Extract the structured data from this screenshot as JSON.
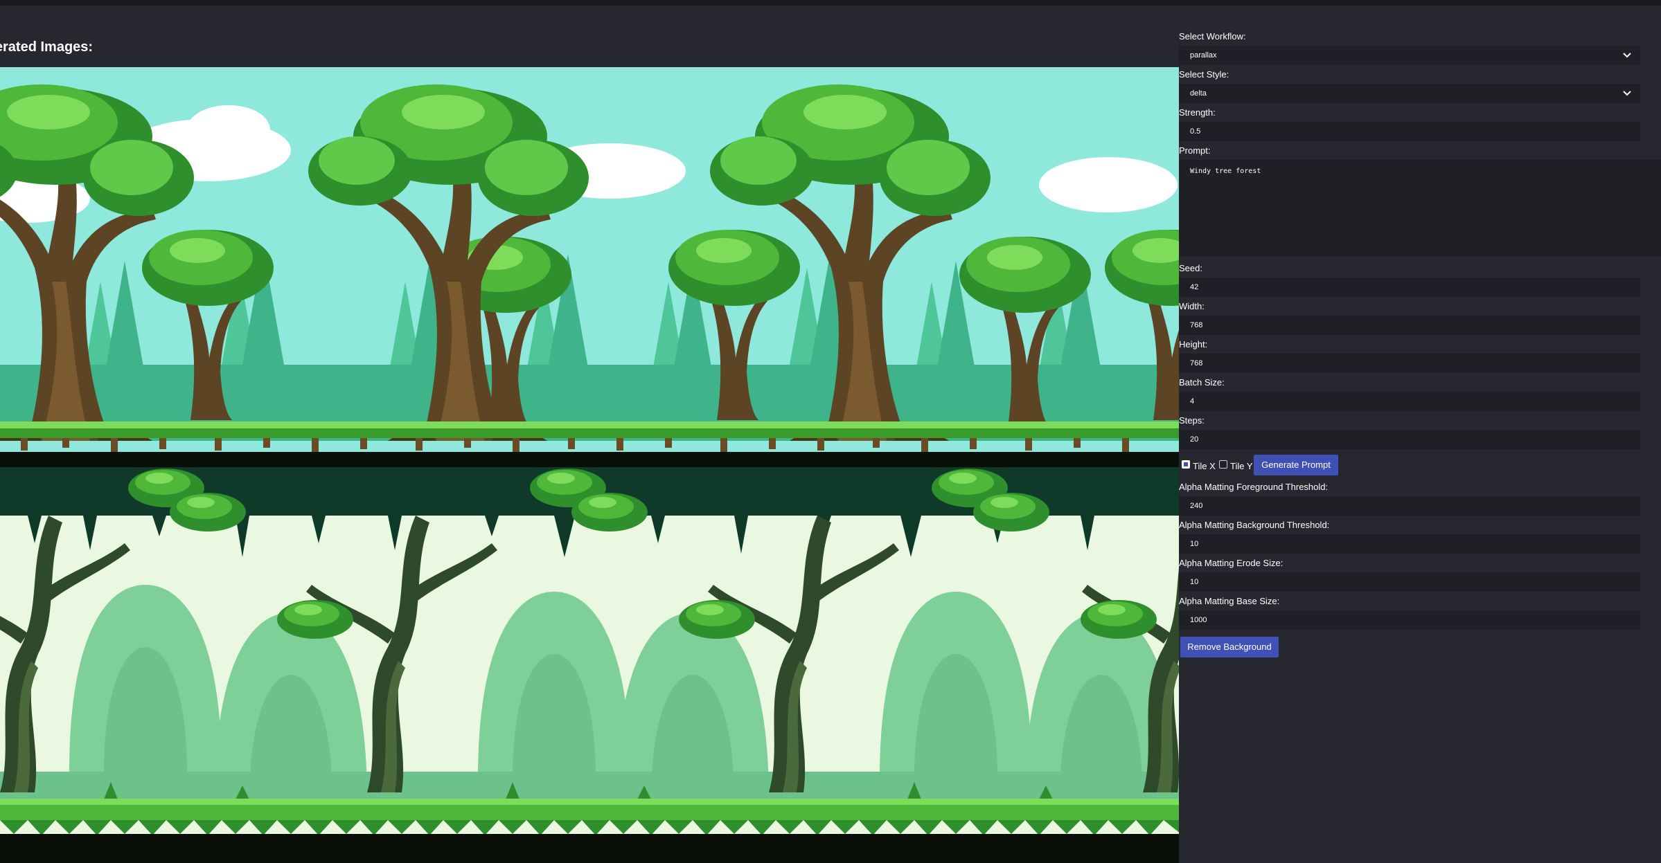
{
  "gallery": {
    "title": "Generated Images:"
  },
  "form": {
    "workflow": {
      "label": "Select Workflow:",
      "value": "parallax"
    },
    "style": {
      "label": "Select Style:",
      "value": "delta"
    },
    "strength": {
      "label": "Strength:",
      "value": "0.5"
    },
    "prompt": {
      "label": "Prompt:",
      "value": "Windy tree forest"
    },
    "seed": {
      "label": "Seed:",
      "value": "42"
    },
    "width": {
      "label": "Width:",
      "value": "768"
    },
    "height": {
      "label": "Height:",
      "value": "768"
    },
    "batch_size": {
      "label": "Batch Size:",
      "value": "4"
    },
    "steps": {
      "label": "Steps:",
      "value": "20"
    },
    "tile_x": {
      "label": "Tile X",
      "checked": true
    },
    "tile_y": {
      "label": "Tile Y",
      "checked": false
    },
    "generate_button": "Generate Prompt",
    "alpha_fg": {
      "label": "Alpha Matting Foreground Threshold:",
      "value": "240"
    },
    "alpha_bg": {
      "label": "Alpha Matting Background Threshold:",
      "value": "10"
    },
    "alpha_erode": {
      "label": "Alpha Matting Erode Size:",
      "value": "10"
    },
    "alpha_base": {
      "label": "Alpha Matting Base Size:",
      "value": "1000"
    },
    "remove_bg_button": "Remove Background"
  },
  "icons": {
    "chevron": "chevron-down-icon"
  },
  "colors": {
    "background": "#27272f",
    "field": "#1f1f26",
    "accent": "#3f51b5",
    "sky_1": "#8fe8dc",
    "sky_2": "#eaf8e2",
    "foliage_light": "#5fc94a",
    "foliage_dark": "#2f8f2c",
    "trunk": "#5c4424",
    "grass": "#4fb83a",
    "soil": "#0a0f0a"
  }
}
